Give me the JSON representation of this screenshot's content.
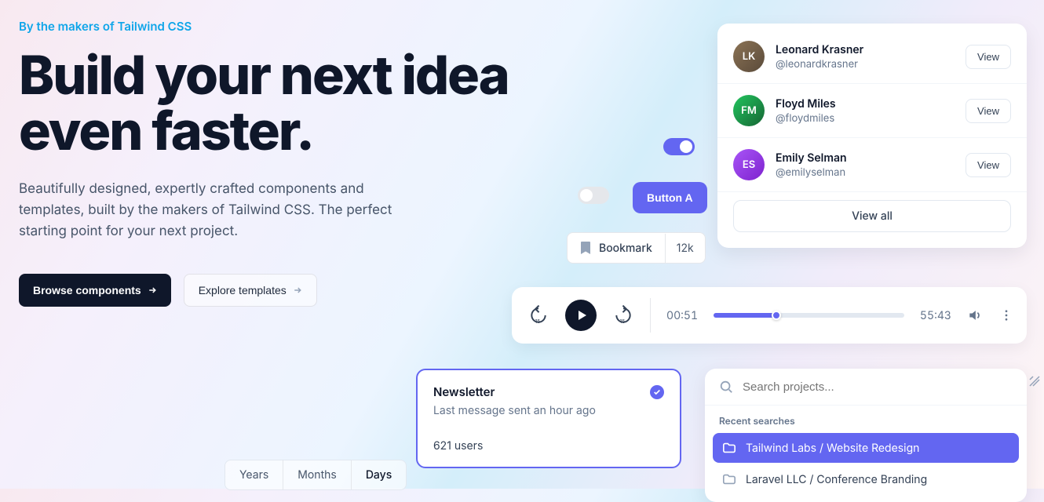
{
  "hero": {
    "eyebrow": "By the makers of Tailwind CSS",
    "headline": "Build your next idea even faster.",
    "subhead": "Beautifully designed, expertly crafted components and templates, built by the makers of Tailwind CSS. The perfect starting point for your next project.",
    "primary_cta": "Browse components",
    "secondary_cta": "Explore templates"
  },
  "toggle_on": true,
  "toggle_off": false,
  "button_a_label": "Button A",
  "bookmark": {
    "label": "Bookmark",
    "count": "12k"
  },
  "people": [
    {
      "name": "Leonard Krasner",
      "handle": "@leonardkrasner",
      "initials": "LK"
    },
    {
      "name": "Floyd Miles",
      "handle": "@floydmiles",
      "initials": "FM"
    },
    {
      "name": "Emily Selman",
      "handle": "@emilyselman",
      "initials": "ES"
    }
  ],
  "view_label": "View",
  "view_all_label": "View all",
  "player": {
    "current": "00:51",
    "total": "55:43",
    "progress_pct": 33
  },
  "newsletter": {
    "title": "Newsletter",
    "sub": "Last message sent an hour ago",
    "users": "621 users"
  },
  "segmented": {
    "options": [
      "Years",
      "Months",
      "Days"
    ],
    "active_index": 2
  },
  "search": {
    "placeholder": "Search projects...",
    "recent_label": "Recent searches",
    "results": [
      {
        "label": "Tailwind Labs / Website Redesign",
        "active": true
      },
      {
        "label": "Laravel LLC / Conference Branding",
        "active": false
      }
    ]
  }
}
